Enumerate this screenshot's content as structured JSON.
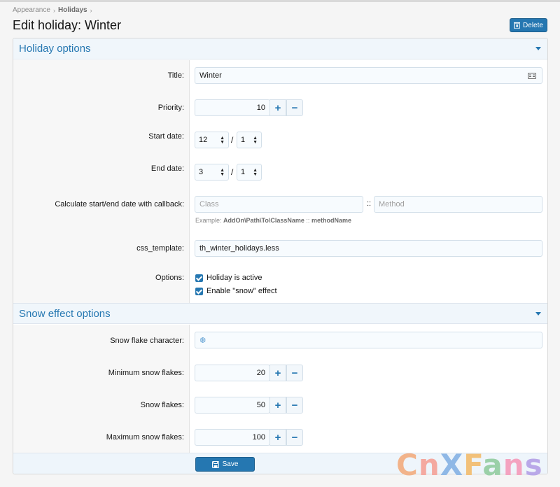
{
  "breadcrumb": [
    {
      "label": "Appearance"
    },
    {
      "label": "Holidays"
    }
  ],
  "page_title": "Edit holiday: Winter",
  "toolbar": {
    "delete_label": "Delete"
  },
  "sections": {
    "holiday": "Holiday options",
    "snow": "Snow effect options"
  },
  "fields": {
    "title": {
      "label": "Title:",
      "value": "Winter"
    },
    "priority": {
      "label": "Priority:",
      "value": "10"
    },
    "start_date": {
      "label": "Start date:",
      "month": "12",
      "day": "1"
    },
    "end_date": {
      "label": "End date:",
      "month": "3",
      "day": "1"
    },
    "callback": {
      "label": "Calculate start/end date with callback:",
      "class_placeholder": "Class",
      "separator": "::",
      "method_placeholder": "Method",
      "example_prefix": "Example:",
      "example_class": "AddOn\\Path\\To\\ClassName",
      "example_sep": "::",
      "example_method": "methodName"
    },
    "css_template": {
      "label": "css_template:",
      "value": "th_winter_holidays.less"
    },
    "options": {
      "label": "Options:",
      "items": [
        {
          "label": "Holiday is active",
          "checked": true
        },
        {
          "label": "Enable \"snow\" effect",
          "checked": true
        }
      ]
    },
    "snow_char": {
      "label": "Snow flake character:",
      "value": "❆"
    },
    "min_flakes": {
      "label": "Minimum snow flakes:",
      "value": "20"
    },
    "flakes": {
      "label": "Snow flakes:",
      "value": "50"
    },
    "max_flakes": {
      "label": "Maximum snow flakes:",
      "value": "100"
    }
  },
  "stepper": {
    "plus": "+",
    "minus": "−"
  },
  "date_separator": "/",
  "save_label": "Save",
  "watermark": [
    "C",
    "n",
    "X",
    "F",
    "a",
    "n",
    "s"
  ],
  "colors": {
    "accent": "#2577b1",
    "header_bg": "#f0f6fb"
  }
}
